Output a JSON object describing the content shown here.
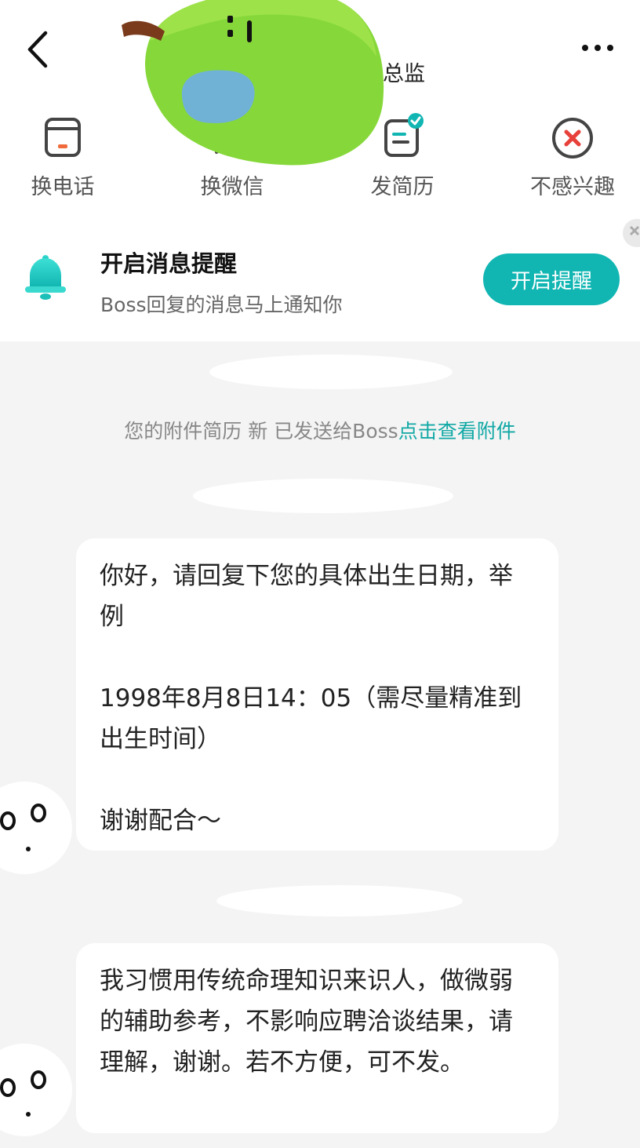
{
  "header": {
    "title_suffix": "总监",
    "actions": [
      {
        "label": "换电话",
        "icon": "phone-card-icon"
      },
      {
        "label": "换微信",
        "icon": "wechat-chat-icon"
      },
      {
        "label": "发简历",
        "icon": "resume-sent-icon"
      },
      {
        "label": "不感兴趣",
        "icon": "not-interested-icon"
      }
    ]
  },
  "notice": {
    "title": "开启消息提醒",
    "subtitle": "Boss回复的消息马上通知你",
    "button_label": "开启提醒"
  },
  "chat": {
    "system_message_prefix": "您的附件简历 新 已发送给Boss",
    "system_message_link": "点击查看附件",
    "messages": [
      {
        "text": "你好，请回复下您的具体出生日期，举例\n\n1998年8月8日14：05（需尽量精准到出生时间）\n\n谢谢配合～"
      },
      {
        "text": "我习惯用传统命理知识来识人，做微弱的辅助参考，不影响应聘洽谈结果，请理解，谢谢。若不方便，可不发。"
      }
    ]
  },
  "colors": {
    "accent": "#11b6b3",
    "link": "#11a8a5",
    "background": "#f4f4f4",
    "bubble": "#ffffff"
  }
}
